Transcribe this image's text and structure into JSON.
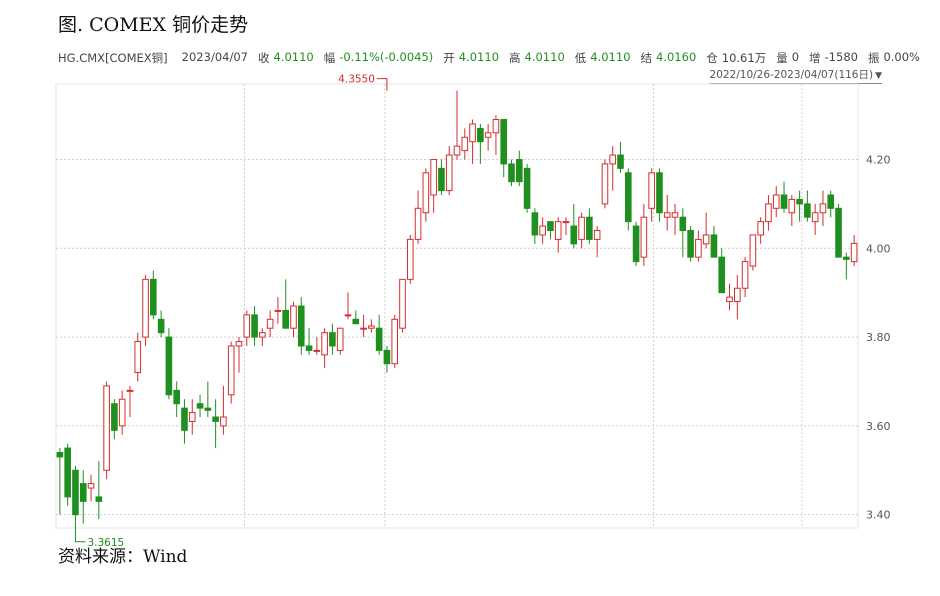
{
  "title": "图. COMEX 铜价走势",
  "quote": {
    "symbol": "HG.CMX[COMEX铜]",
    "date": "2023/04/07",
    "close_label": "收",
    "close_value": "4.0110",
    "change_label": "幅",
    "change_value": "-0.11%(-0.0045)",
    "open_label": "开",
    "open_value": "4.0110",
    "high_label": "高",
    "high_value": "4.0110",
    "low_label": "低",
    "low_value": "4.0110",
    "settle_label": "结",
    "settle_value": "4.0160",
    "oi_label": "仓",
    "oi_value": "10.61万",
    "volume_label": "量",
    "volume_value": "0",
    "increase_label": "增",
    "increase_value": "-1580",
    "amplitude_label": "振",
    "amplitude_value": "0.00%"
  },
  "range_label": "2022/10/26-2023/04/07(116日)",
  "source": "资料来源：Wind",
  "colors": {
    "up": "#d62d2d",
    "down": "#1f8f1f",
    "grid": "#cfcfcf"
  },
  "chart_data": {
    "type": "candlestick",
    "title": "",
    "ylim": [
      3.37,
      4.37
    ],
    "yticks": [
      "3.40",
      "3.60",
      "3.80",
      "4.00",
      "4.20"
    ],
    "y_axis_position": "right",
    "grid": true,
    "annotations": [
      {
        "label": "4.3550",
        "value": 4.355,
        "candle_index": 42,
        "type": "max"
      },
      {
        "label": "3.3615",
        "value": 3.3615,
        "candle_index": 2,
        "type": "min"
      }
    ],
    "candles": [
      [
        3.54,
        3.55,
        3.4,
        3.53
      ],
      [
        3.55,
        3.56,
        3.42,
        3.44
      ],
      [
        3.5,
        3.51,
        3.3615,
        3.4
      ],
      [
        3.47,
        3.5,
        3.38,
        3.43
      ],
      [
        3.46,
        3.49,
        3.43,
        3.47
      ],
      [
        3.44,
        3.52,
        3.39,
        3.43
      ],
      [
        3.5,
        3.7,
        3.48,
        3.69
      ],
      [
        3.65,
        3.66,
        3.57,
        3.59
      ],
      [
        3.6,
        3.68,
        3.58,
        3.66
      ],
      [
        3.68,
        3.69,
        3.62,
        3.68
      ],
      [
        3.72,
        3.81,
        3.7,
        3.79
      ],
      [
        3.8,
        3.94,
        3.78,
        3.93
      ],
      [
        3.93,
        3.95,
        3.84,
        3.85
      ],
      [
        3.84,
        3.86,
        3.8,
        3.81
      ],
      [
        3.8,
        3.82,
        3.66,
        3.67
      ],
      [
        3.68,
        3.7,
        3.62,
        3.65
      ],
      [
        3.64,
        3.66,
        3.56,
        3.59
      ],
      [
        3.61,
        3.66,
        3.58,
        3.63
      ],
      [
        3.65,
        3.67,
        3.62,
        3.64
      ],
      [
        3.64,
        3.7,
        3.62,
        3.635
      ],
      [
        3.62,
        3.66,
        3.55,
        3.61
      ],
      [
        3.6,
        3.69,
        3.58,
        3.62
      ],
      [
        3.67,
        3.79,
        3.65,
        3.78
      ],
      [
        3.78,
        3.8,
        3.72,
        3.79
      ],
      [
        3.8,
        3.86,
        3.78,
        3.85
      ],
      [
        3.85,
        3.87,
        3.78,
        3.8
      ],
      [
        3.8,
        3.82,
        3.78,
        3.81
      ],
      [
        3.82,
        3.86,
        3.8,
        3.84
      ],
      [
        3.86,
        3.89,
        3.83,
        3.86
      ],
      [
        3.86,
        3.93,
        3.82,
        3.82
      ],
      [
        3.82,
        3.88,
        3.8,
        3.87
      ],
      [
        3.87,
        3.89,
        3.76,
        3.78
      ],
      [
        3.78,
        3.82,
        3.76,
        3.77
      ],
      [
        3.77,
        3.8,
        3.76,
        3.77
      ],
      [
        3.76,
        3.82,
        3.73,
        3.81
      ],
      [
        3.81,
        3.83,
        3.76,
        3.78
      ],
      [
        3.77,
        3.82,
        3.76,
        3.82
      ],
      [
        3.85,
        3.9,
        3.84,
        3.85
      ],
      [
        3.84,
        3.86,
        3.83,
        3.83
      ],
      [
        3.82,
        3.85,
        3.8,
        3.82
      ],
      [
        3.82,
        3.84,
        3.81,
        3.825
      ],
      [
        3.82,
        3.85,
        3.76,
        3.77
      ],
      [
        3.77,
        3.78,
        3.72,
        3.74
      ],
      [
        3.74,
        3.85,
        3.73,
        3.84
      ],
      [
        3.82,
        3.93,
        3.81,
        3.93
      ],
      [
        3.93,
        4.03,
        3.92,
        4.02
      ],
      [
        4.02,
        4.13,
        4.01,
        4.09
      ],
      [
        4.08,
        4.18,
        4.06,
        4.17
      ],
      [
        4.12,
        4.2,
        4.08,
        4.2
      ],
      [
        4.18,
        4.2,
        4.12,
        4.13
      ],
      [
        4.13,
        4.23,
        4.12,
        4.21
      ],
      [
        4.21,
        4.355,
        4.2,
        4.23
      ],
      [
        4.22,
        4.27,
        4.2,
        4.25
      ],
      [
        4.24,
        4.29,
        4.19,
        4.28
      ],
      [
        4.27,
        4.28,
        4.19,
        4.24
      ],
      [
        4.25,
        4.28,
        4.22,
        4.26
      ],
      [
        4.26,
        4.3,
        4.21,
        4.29
      ],
      [
        4.29,
        4.29,
        4.16,
        4.19
      ],
      [
        4.19,
        4.2,
        4.14,
        4.15
      ],
      [
        4.2,
        4.22,
        4.14,
        4.15
      ],
      [
        4.18,
        4.19,
        4.08,
        4.09
      ],
      [
        4.08,
        4.09,
        4.01,
        4.03
      ],
      [
        4.03,
        4.07,
        4.01,
        4.05
      ],
      [
        4.06,
        4.06,
        4.02,
        4.04
      ],
      [
        4.02,
        4.07,
        3.99,
        4.06
      ],
      [
        4.06,
        4.07,
        4.03,
        4.06
      ],
      [
        4.05,
        4.1,
        4.0,
        4.01
      ],
      [
        4.02,
        4.08,
        4.0,
        4.07
      ],
      [
        4.07,
        4.09,
        4.01,
        4.02
      ],
      [
        4.02,
        4.05,
        3.98,
        4.04
      ],
      [
        4.1,
        4.2,
        4.09,
        4.19
      ],
      [
        4.19,
        4.23,
        4.13,
        4.21
      ],
      [
        4.21,
        4.24,
        4.17,
        4.18
      ],
      [
        4.17,
        4.18,
        4.04,
        4.06
      ],
      [
        4.05,
        4.06,
        3.96,
        3.97
      ],
      [
        3.98,
        4.1,
        3.96,
        4.07
      ],
      [
        4.09,
        4.18,
        4.06,
        4.17
      ],
      [
        4.17,
        4.18,
        4.06,
        4.08
      ],
      [
        4.07,
        4.12,
        4.04,
        4.08
      ],
      [
        4.07,
        4.1,
        4.03,
        4.08
      ],
      [
        4.07,
        4.09,
        3.98,
        4.04
      ],
      [
        4.04,
        4.05,
        3.97,
        3.98
      ],
      [
        3.98,
        4.04,
        3.97,
        4.02
      ],
      [
        4.01,
        4.08,
        4.0,
        4.03
      ],
      [
        4.03,
        4.05,
        3.98,
        3.98
      ],
      [
        3.98,
        4.0,
        3.9,
        3.9
      ],
      [
        3.88,
        3.92,
        3.86,
        3.89
      ],
      [
        3.88,
        3.94,
        3.84,
        3.91
      ],
      [
        3.91,
        3.98,
        3.89,
        3.97
      ],
      [
        3.96,
        4.03,
        3.95,
        4.03
      ],
      [
        4.03,
        4.07,
        4.01,
        4.06
      ],
      [
        4.06,
        4.12,
        4.04,
        4.1
      ],
      [
        4.09,
        4.14,
        4.07,
        4.12
      ],
      [
        4.12,
        4.15,
        4.08,
        4.09
      ],
      [
        4.08,
        4.12,
        4.05,
        4.11
      ],
      [
        4.11,
        4.13,
        4.06,
        4.1
      ],
      [
        4.1,
        4.13,
        4.06,
        4.07
      ],
      [
        4.06,
        4.1,
        4.03,
        4.08
      ],
      [
        4.08,
        4.13,
        4.05,
        4.1
      ],
      [
        4.12,
        4.13,
        4.07,
        4.09
      ],
      [
        4.09,
        4.1,
        3.98,
        3.98
      ],
      [
        3.98,
        3.99,
        3.93,
        3.975
      ],
      [
        3.97,
        4.03,
        3.96,
        4.011
      ]
    ]
  }
}
